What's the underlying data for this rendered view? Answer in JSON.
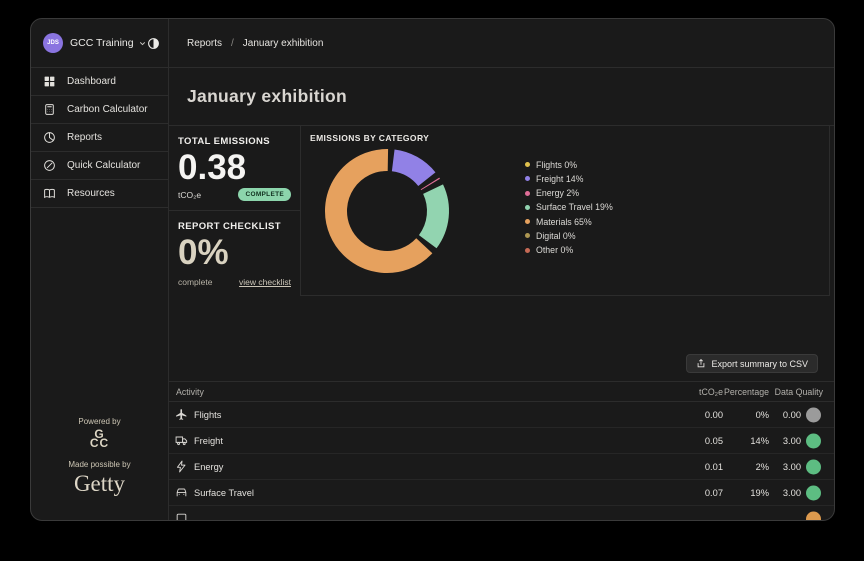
{
  "sidebar": {
    "org": {
      "avatar_initials": "JDS",
      "name": "GCC Training"
    },
    "items": [
      {
        "label": "Dashboard",
        "icon": "grid-icon"
      },
      {
        "label": "Carbon Calculator",
        "icon": "calculator-icon"
      },
      {
        "label": "Reports",
        "icon": "pie-chart-icon"
      },
      {
        "label": "Quick Calculator",
        "icon": "gauge-icon"
      },
      {
        "label": "Resources",
        "icon": "book-icon"
      }
    ],
    "footer": {
      "powered_by": "Powered by",
      "logo_line1": "G",
      "logo_line2": "CC",
      "made_possible_by": "Made possible by",
      "getty": "Getty"
    }
  },
  "breadcrumb": {
    "items": [
      "Reports",
      "January exhibition"
    ],
    "separator": "/"
  },
  "page": {
    "title": "January exhibition"
  },
  "cards": {
    "total_emissions": {
      "label": "TOTAL EMISSIONS",
      "value": "0.38",
      "unit": "tCO₂e",
      "badge": "COMPLETE",
      "badge_color": "#8cd5ac"
    },
    "report_checklist": {
      "label": "REPORT CHECKLIST",
      "value": "0%",
      "caption": "complete",
      "link": "view checklist"
    }
  },
  "chart_data": {
    "type": "pie",
    "subtype": "donut",
    "title": "EMISSIONS BY CATEGORY",
    "categories": [
      "Flights",
      "Freight",
      "Energy",
      "Surface Travel",
      "Materials",
      "Digital",
      "Other"
    ],
    "values": [
      0,
      14,
      2,
      19,
      65,
      0,
      0
    ],
    "unit": "%",
    "colors": [
      "#e0c14d",
      "#9181e6",
      "#df6d97",
      "#92d4b0",
      "#e6a15e",
      "#ad9752",
      "#c66a55"
    ],
    "legend_position": "right",
    "legend_entries": [
      "Flights 0%",
      "Freight 14%",
      "Energy 2%",
      "Surface Travel 19%",
      "Materials 65%",
      "Digital 0%",
      "Other 0%"
    ]
  },
  "toolbar": {
    "export_label": "Export summary to CSV"
  },
  "table": {
    "columns": [
      "Activity",
      "tCO₂e",
      "Percentage",
      "Data Quality"
    ],
    "rows": [
      {
        "activity": "Flights",
        "icon": "plane-icon",
        "tco2e": "0.00",
        "percentage": "0%",
        "data_quality": "0.00",
        "quality_color": "#9b9b9b"
      },
      {
        "activity": "Freight",
        "icon": "truck-icon",
        "tco2e": "0.05",
        "percentage": "14%",
        "data_quality": "3.00",
        "quality_color": "#5dbd82"
      },
      {
        "activity": "Energy",
        "icon": "bolt-icon",
        "tco2e": "0.01",
        "percentage": "2%",
        "data_quality": "3.00",
        "quality_color": "#5dbd82"
      },
      {
        "activity": "Surface Travel",
        "icon": "car-icon",
        "tco2e": "0.07",
        "percentage": "19%",
        "data_quality": "3.00",
        "quality_color": "#5dbd82"
      },
      {
        "activity": "",
        "icon": "box-icon",
        "tco2e": "",
        "percentage": "",
        "data_quality": "",
        "quality_color": "#dd9a4e"
      }
    ]
  }
}
